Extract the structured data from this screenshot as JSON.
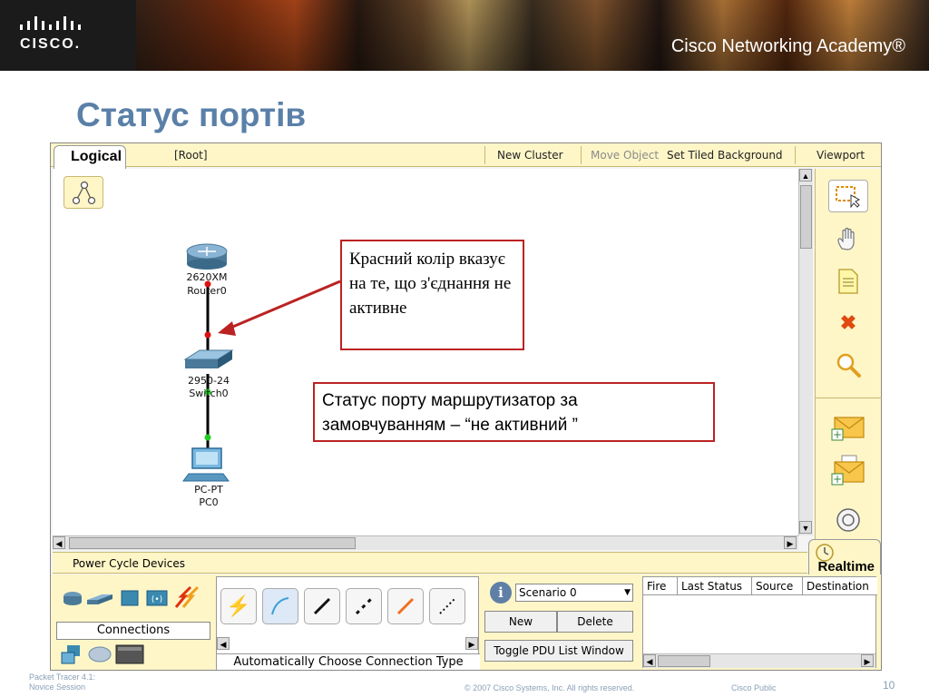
{
  "header": {
    "brand": "CISCO.",
    "academy": "Cisco Networking Academy®"
  },
  "slide": {
    "title": "Статус портів"
  },
  "packet_tracer": {
    "workspace_tab": "Logical",
    "toolbar": {
      "root": "[Root]",
      "new_cluster": "New Cluster",
      "move_object": "Move Object",
      "set_tiled_background": "Set Tiled Background",
      "viewport": "Viewport"
    },
    "mode_tab": "Realtime",
    "power_cycle": "Power Cycle Devices",
    "devices": [
      {
        "model": "2620XM",
        "name": "Router0"
      },
      {
        "model": "2950-24",
        "name": "Switch0"
      },
      {
        "model": "PC-PT",
        "name": "PC0"
      }
    ],
    "link_status_colors": {
      "inactive": "#dd1111",
      "active": "#22cc22"
    },
    "connections_label": "Connections",
    "auto_connection_label": "Automatically Choose Connection Type",
    "scenario": {
      "selected": "Scenario 0",
      "new_label": "New",
      "delete_label": "Delete",
      "toggle_label": "Toggle PDU List Window"
    },
    "pdu_columns": [
      "Fire",
      "Last Status",
      "Source",
      "Destination"
    ],
    "right_tools": [
      "select-icon",
      "hand-icon",
      "note-icon",
      "delete-icon",
      "inspect-icon",
      "add-simple-pdu-icon",
      "add-complex-pdu-icon"
    ]
  },
  "callouts": {
    "red_meaning": "Красний колір вказує на те, що з'єднання не активне",
    "router_port_status": "Статус порту маршрутизатор за замовчуванням – “не активний ”"
  },
  "footer": {
    "line1": "Packet Tracer 4.1:",
    "line2": "Novice Session",
    "copyright": "© 2007 Cisco Systems, Inc. All rights reserved.",
    "classification": "Cisco Public",
    "page": "10"
  }
}
